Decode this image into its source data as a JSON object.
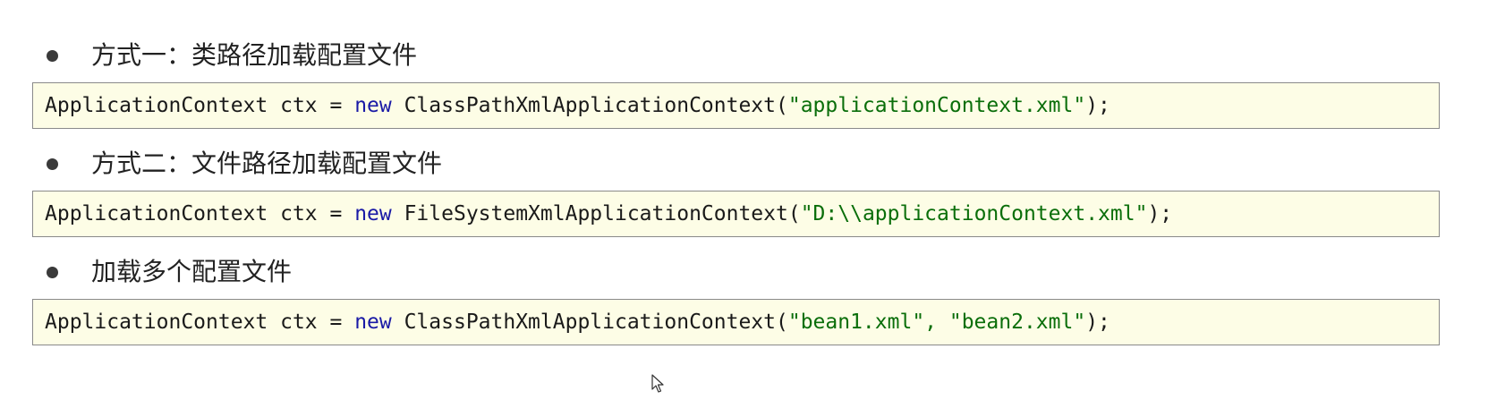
{
  "sections": [
    {
      "bullet": "方式一：类路径加载配置文件",
      "code": {
        "type": "ApplicationContext",
        "var": " ctx = ",
        "keyword": "new",
        "ctor": " ClassPathXmlApplicationContext(",
        "args": "\"applicationContext.xml\"",
        "end": ");"
      }
    },
    {
      "bullet": "方式二：文件路径加载配置文件",
      "code": {
        "type": "ApplicationContext",
        "var": " ctx = ",
        "keyword": "new",
        "ctor": " FileSystemXmlApplicationContext(",
        "args": "\"D:\\\\applicationContext.xml\"",
        "end": ");"
      }
    },
    {
      "bullet": "加载多个配置文件",
      "code": {
        "type": "ApplicationContext",
        "var": " ctx = ",
        "keyword": "new",
        "ctor": " ClassPathXmlApplicationContext(",
        "args": "\"bean1.xml\", \"bean2.xml\"",
        "end": ");"
      }
    }
  ],
  "colors": {
    "keyword": "#1a1aa6",
    "string": "#0a6e0a",
    "code_background": "#fdfde6"
  },
  "icons": {
    "cursor": "mouse-pointer-icon"
  }
}
